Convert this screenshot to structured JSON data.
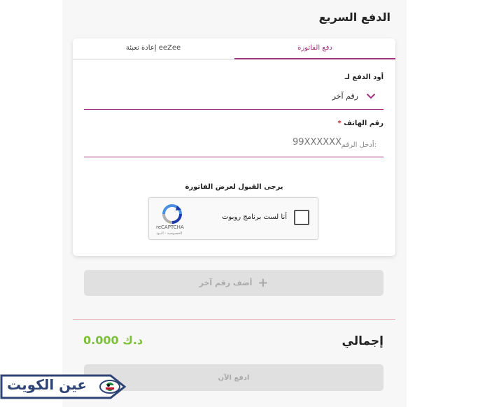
{
  "header": {
    "title": "الدفع السريع"
  },
  "tabs": [
    {
      "label": "دفع الفاتورة",
      "active": true
    },
    {
      "label": "إعادة تعبئة eeZee",
      "active": false
    }
  ],
  "form": {
    "pay_for_label": "أود الدفع لـ",
    "pay_for_value": "رقم آخر",
    "phone_label": "رقم الهاتف",
    "required_mark": "*",
    "phone_prefix": "أدخل الرقم:",
    "phone_placeholder": "99XXXXXX"
  },
  "captcha": {
    "instruction": "يرجى القبول لعرض الفاتورة",
    "checkbox_label": "أنا لست برنامج روبوت",
    "brand": "reCAPTCHA",
    "links": "الخصوصية - البنود"
  },
  "actions": {
    "add_number_label": "أضف رقم آخر",
    "add_icon": "+",
    "pay_now_label": "ادفع الآن"
  },
  "summary": {
    "total_label": "إجمالي",
    "total_amount": "0.000 د.ك"
  },
  "watermark": {
    "text": "عين الكويت"
  },
  "colors": {
    "accent": "#a3337e",
    "amount": "#7bbf3a",
    "disabled": "#e0e0e0"
  }
}
